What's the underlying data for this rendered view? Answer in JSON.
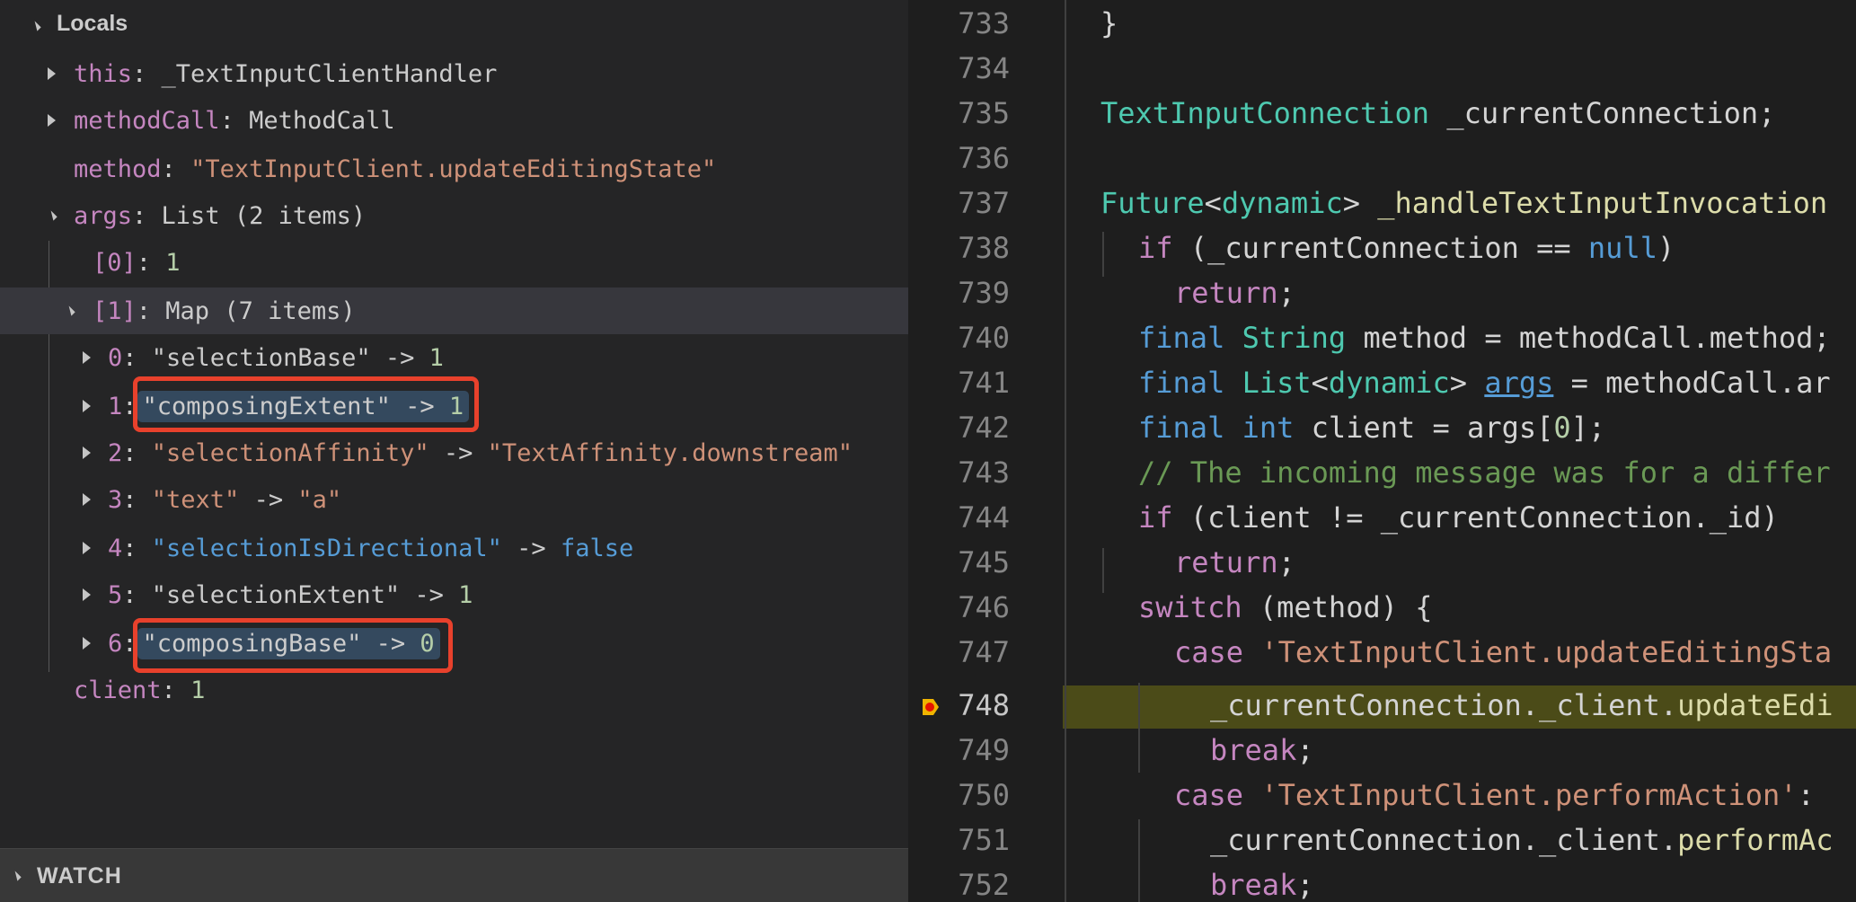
{
  "debug": {
    "locals_title": "Locals",
    "watch_title": "WATCH",
    "rows": [
      {
        "name": "this",
        "sep": ": ",
        "value": "_TextInputClientHandler"
      },
      {
        "name": "methodCall",
        "sep": ": ",
        "value": "MethodCall"
      },
      {
        "name": "method",
        "sep": ": ",
        "value": "\"TextInputClient.updateEditingState\""
      },
      {
        "name": "args",
        "sep": ": ",
        "value": "List (2 items)"
      },
      {
        "name": "[0]",
        "sep": ": ",
        "value": "1"
      },
      {
        "name": "[1]",
        "sep": ": ",
        "value": "Map (7 items)"
      },
      {
        "name": "0",
        "sep": ": ",
        "key": "\"selectionBase\"",
        "arrow": " -> ",
        "value": "1"
      },
      {
        "name": "1",
        "sep": ":",
        "key": "\"composingExtent\"",
        "arrow": " -> ",
        "value": "1"
      },
      {
        "name": "2",
        "sep": ": ",
        "key": "\"selectionAffinity\"",
        "arrow": " -> ",
        "value": "\"TextAffinity.downstream\""
      },
      {
        "name": "3",
        "sep": ": ",
        "key": "\"text\"",
        "arrow": " -> ",
        "value": "\"a\""
      },
      {
        "name": "4",
        "sep": ": ",
        "key": "\"selectionIsDirectional\"",
        "arrow": " -> ",
        "value": "false"
      },
      {
        "name": "5",
        "sep": ": ",
        "key": "\"selectionExtent\"",
        "arrow": " -> ",
        "value": "1"
      },
      {
        "name": "6",
        "sep": ":",
        "key": "\"composingBase\"",
        "arrow": " -> ",
        "value": "0"
      },
      {
        "name": "client",
        "sep": ": ",
        "value": "1"
      }
    ]
  },
  "editor": {
    "lines": [
      {
        "n": "733",
        "t": [
          "}"
        ]
      },
      {
        "n": "734",
        "t": [
          ""
        ]
      },
      {
        "n": "735",
        "t": [
          "TextInputConnection",
          " _currentConnection;"
        ]
      },
      {
        "n": "736",
        "t": [
          ""
        ]
      },
      {
        "n": "737",
        "t": [
          "Future",
          "<",
          "dynamic",
          "> ",
          "_handleTextInputInvocation"
        ]
      },
      {
        "n": "738",
        "t": [
          "if",
          " (_currentConnection == ",
          "null",
          ")"
        ]
      },
      {
        "n": "739",
        "t": [
          "return",
          ";"
        ]
      },
      {
        "n": "740",
        "t": [
          "final",
          " ",
          "String",
          " method = methodCall.method;"
        ]
      },
      {
        "n": "741",
        "t": [
          "final",
          " ",
          "List",
          "<",
          "dynamic",
          "> ",
          "args",
          " = methodCall.ar"
        ]
      },
      {
        "n": "742",
        "t": [
          "final",
          " ",
          "int",
          " client = args[",
          "0",
          "];"
        ]
      },
      {
        "n": "743",
        "t": [
          "// The incoming message was for a differ"
        ]
      },
      {
        "n": "744",
        "t": [
          "if",
          " (client != _currentConnection._id)"
        ]
      },
      {
        "n": "745",
        "t": [
          "return",
          ";"
        ]
      },
      {
        "n": "746",
        "t": [
          "switch",
          " (method) {"
        ]
      },
      {
        "n": "747",
        "t": [
          "case",
          " ",
          "'TextInputClient.updateEditingSta"
        ]
      },
      {
        "n": "748",
        "t": [
          "_currentConnection._client.",
          "updateEdi"
        ]
      },
      {
        "n": "749",
        "t": [
          "break",
          ";"
        ]
      },
      {
        "n": "750",
        "t": [
          "case",
          " ",
          "'TextInputClient.performAction'",
          ":"
        ]
      },
      {
        "n": "751",
        "t": [
          "_currentConnection._client.",
          "performAc"
        ]
      },
      {
        "n": "752",
        "t": [
          "break",
          ";"
        ]
      }
    ]
  },
  "colors": {
    "highlight_box": "#e8412c",
    "current_line": "#4b4b18",
    "breakpoint": "#f0b400"
  }
}
